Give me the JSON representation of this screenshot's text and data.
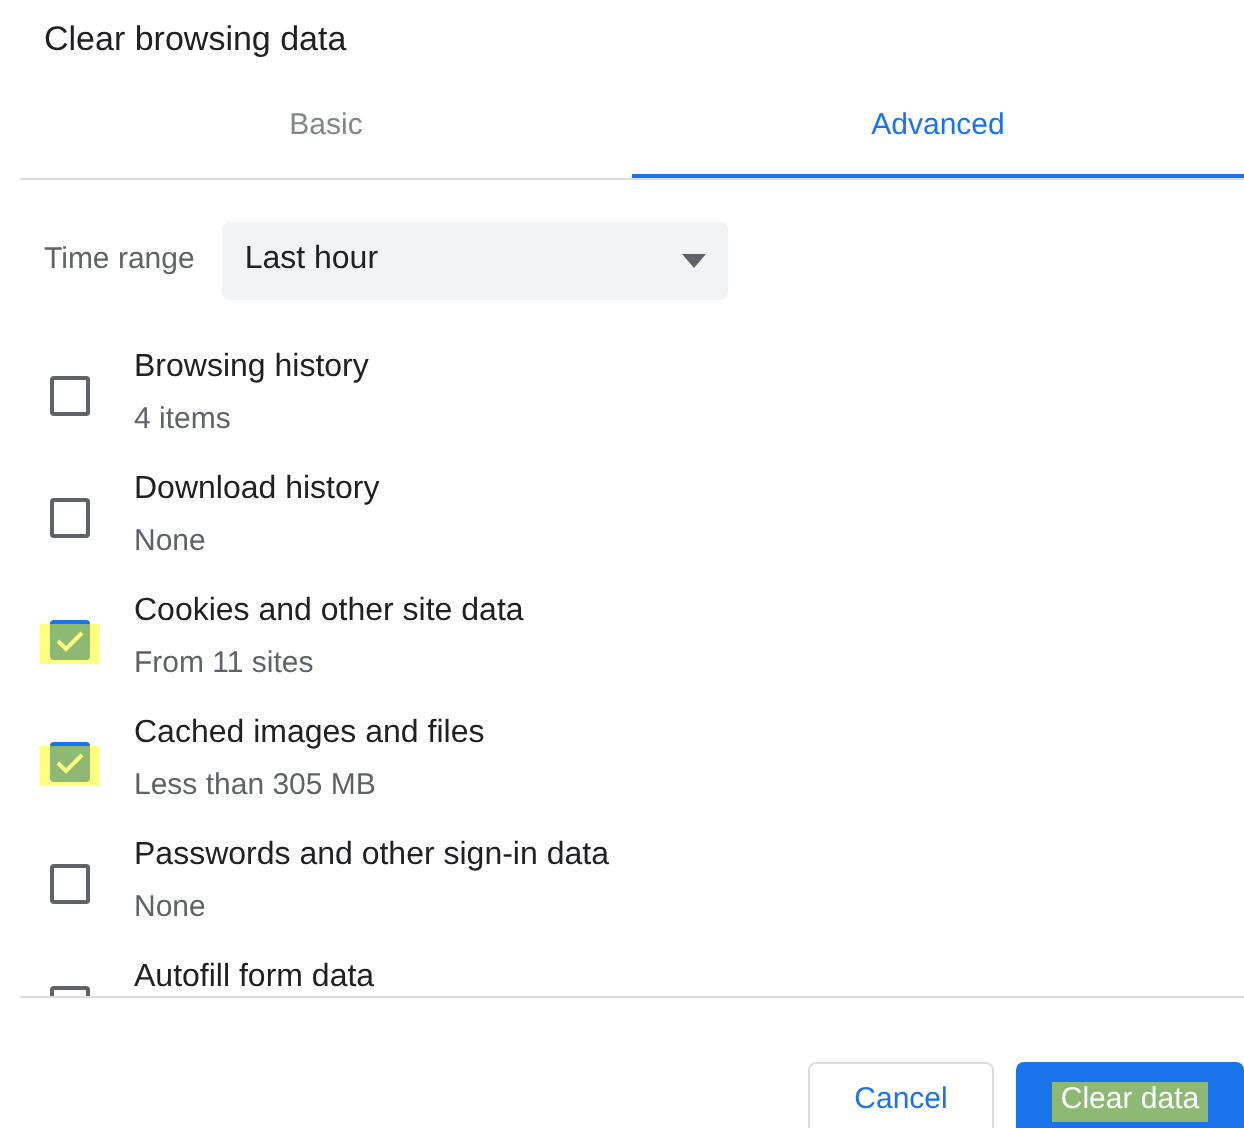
{
  "dialog": {
    "title": "Clear browsing data"
  },
  "tabs": [
    {
      "label": "Basic",
      "selected": false
    },
    {
      "label": "Advanced",
      "selected": true
    }
  ],
  "time_range": {
    "label": "Time range",
    "value": "Last hour"
  },
  "items": [
    {
      "label": "Browsing history",
      "detail": "4 items",
      "checked": false,
      "highlighted": false
    },
    {
      "label": "Download history",
      "detail": "None",
      "checked": false,
      "highlighted": false
    },
    {
      "label": "Cookies and other site data",
      "detail": "From 11 sites",
      "checked": true,
      "highlighted": true
    },
    {
      "label": "Cached images and files",
      "detail": "Less than 305 MB",
      "checked": true,
      "highlighted": true
    },
    {
      "label": "Passwords and other sign-in data",
      "detail": "None",
      "checked": false,
      "highlighted": false
    },
    {
      "label": "Autofill form data",
      "checked": false,
      "highlighted": false
    }
  ],
  "buttons": [
    {
      "label": "Cancel",
      "kind": "secondary",
      "highlighted": false
    },
    {
      "label": "Clear data",
      "kind": "primary",
      "highlighted": true
    }
  ]
}
